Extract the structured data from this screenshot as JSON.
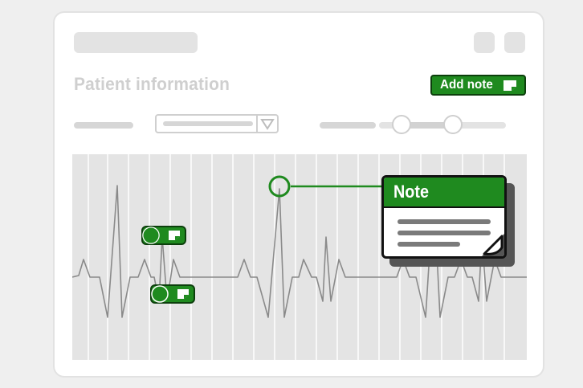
{
  "window": {
    "heading": "Patient information",
    "add_note_label": "Add note"
  },
  "note": {
    "title": "Note"
  },
  "icons": {
    "note": "note-icon",
    "dropdown": "triangle-down-icon"
  },
  "slider": {
    "range": [
      0.18,
      0.58
    ]
  },
  "colors": {
    "accent": "#1f8a1f",
    "accent_dark": "#0c3f0c",
    "placeholder": "#e3e3e3",
    "waveform": "#888888"
  }
}
